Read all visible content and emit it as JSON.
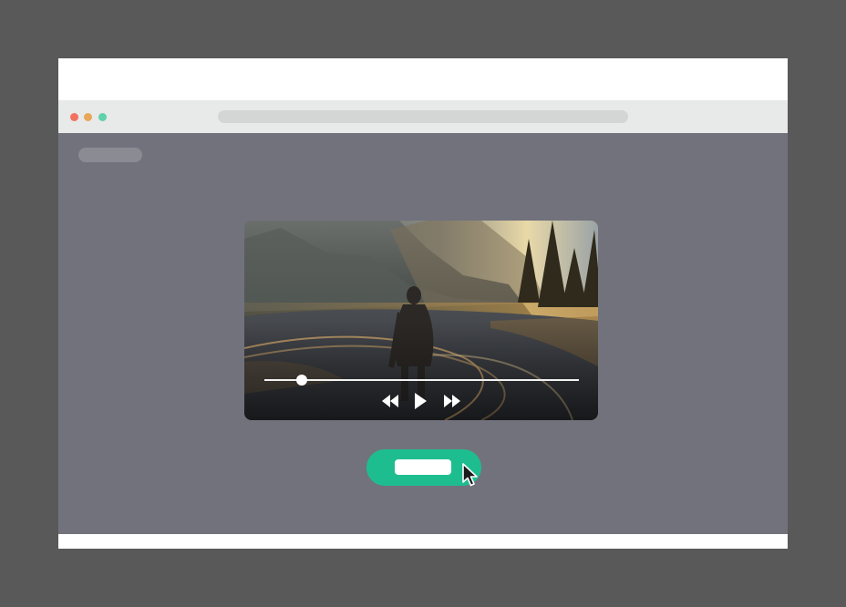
{
  "window": {
    "traffic_lights": [
      {
        "name": "close",
        "color": "#f2725f"
      },
      {
        "name": "minimize",
        "color": "#e9a75a"
      },
      {
        "name": "maximize",
        "color": "#5fd1ab"
      }
    ]
  },
  "player": {
    "progress": 0.12,
    "controls": [
      "rewind-icon",
      "play-icon",
      "fast-forward-icon"
    ]
  },
  "colors": {
    "page_background": "#595959",
    "viewport_background": "#72727d",
    "cta_green": "#1ebd8f"
  }
}
